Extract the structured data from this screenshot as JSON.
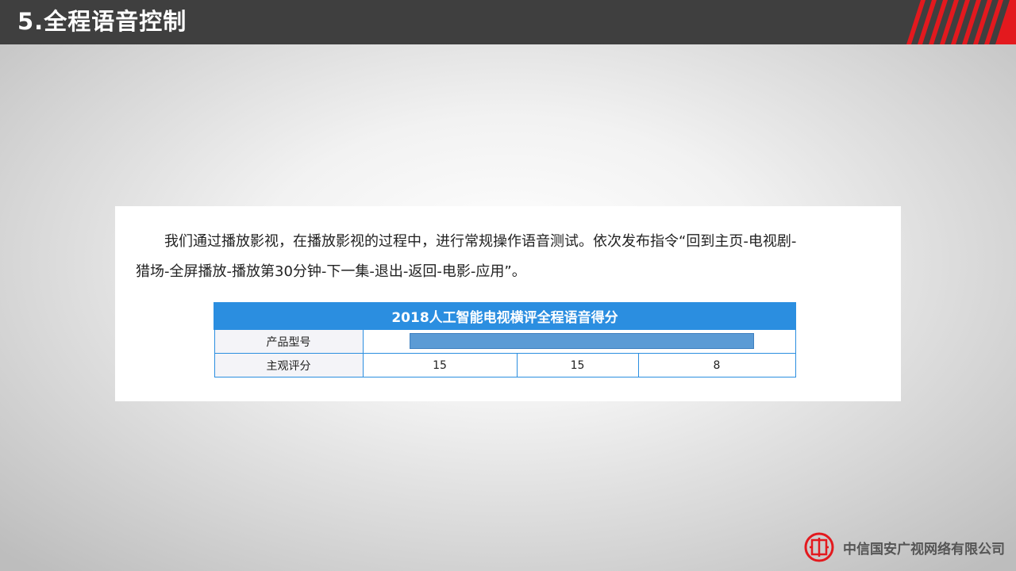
{
  "header": {
    "title": "5.全程语音控制"
  },
  "content": {
    "paragraph_line1": "我们通过播放影视，在播放影视的过程中，进行常规操作语音测试。依次发布指令“回到主页-电视剧-",
    "paragraph_line2": "猎场-全屏播放-播放第30分钟-下一集-退出-返回-电影-应用”。"
  },
  "table": {
    "title": "2018人工智能电视横评全程语音得分",
    "row_model_label": "产品型号",
    "row_score_label": "主观评分",
    "scores": [
      "15",
      "15",
      "8"
    ]
  },
  "footer": {
    "company": "中信国安广视网络有限公司",
    "logo_icon": "citic-logo-icon"
  },
  "colors": {
    "header_bg": "#3f3f3f",
    "accent_red": "#e3191e",
    "table_blue": "#2b8ee0",
    "redaction_blue": "#5b9bd5"
  }
}
